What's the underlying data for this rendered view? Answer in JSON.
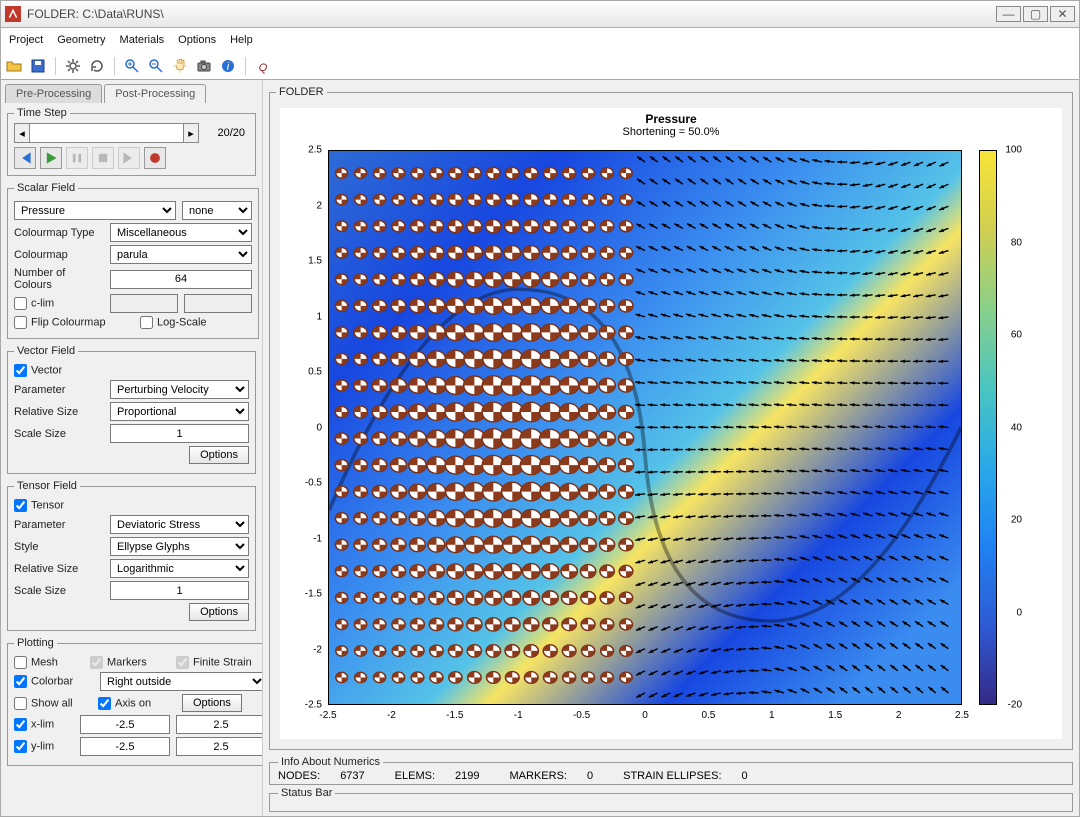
{
  "window": {
    "title": "FOLDER: C:\\Data\\RUNS\\"
  },
  "menu": [
    "Project",
    "Geometry",
    "Materials",
    "Options",
    "Help"
  ],
  "tabs": {
    "pre": "Pre-Processing",
    "post": "Post-Processing",
    "active": "post"
  },
  "timestep": {
    "legend": "Time Step",
    "label": "20/20"
  },
  "scalar": {
    "legend": "Scalar Field",
    "field": "Pressure",
    "second": "none",
    "colourmap_type_label": "Colourmap Type",
    "colourmap_type": "Miscellaneous",
    "colourmap_label": "Colourmap",
    "colourmap": "parula",
    "numcolours_label": "Number of Colours",
    "numcolours": "64",
    "clim_label": "c-lim",
    "flip_label": "Flip Colourmap",
    "log_label": "Log-Scale"
  },
  "vector": {
    "legend": "Vector Field",
    "enable_label": "Vector",
    "param_label": "Parameter",
    "param": "Perturbing Velocity",
    "relsize_label": "Relative Size",
    "relsize": "Proportional",
    "scale_label": "Scale Size",
    "scale": "1",
    "options": "Options"
  },
  "tensor": {
    "legend": "Tensor Field",
    "enable_label": "Tensor",
    "param_label": "Parameter",
    "param": "Deviatoric Stress",
    "style_label": "Style",
    "style": "Ellypse Glyphs",
    "relsize_label": "Relative Size",
    "relsize": "Logarithmic",
    "scale_label": "Scale Size",
    "scale": "1",
    "options": "Options"
  },
  "plotting": {
    "legend": "Plotting",
    "mesh": "Mesh",
    "markers": "Markers",
    "finite_strain": "Finite Strain",
    "colorbar": "Colorbar",
    "colorbar_pos": "Right outside",
    "showall": "Show all",
    "axis_on": "Axis on",
    "options": "Options",
    "xlim": "x-lim",
    "ylim": "y-lim",
    "xmin": "-2.5",
    "xmax": "2.5",
    "ymin": "-2.5",
    "ymax": "2.5"
  },
  "plot_frame_legend": "FOLDER",
  "info": {
    "legend": "Info About Numerics",
    "nodes_l": "NODES:",
    "nodes": "6737",
    "elems_l": "ELEMS:",
    "elems": "2199",
    "markers_l": "MARKERS:",
    "markers": "0",
    "strain_l": "STRAIN ELLIPSES:",
    "strain": "0"
  },
  "statusbar_legend": "Status Bar",
  "chart_data": {
    "type": "heatmap",
    "title": "Pressure",
    "subtitle": "Shortening = 50.0%",
    "xlabel": "",
    "ylabel": "",
    "xlim": [
      -2.5,
      2.5
    ],
    "ylim": [
      -2.5,
      2.5
    ],
    "xticks": [
      -2.5,
      -2,
      -1.5,
      -1,
      -0.5,
      0,
      0.5,
      1,
      1.5,
      2,
      2.5
    ],
    "yticks": [
      -2.5,
      -2,
      -1.5,
      -1,
      -0.5,
      0,
      0.5,
      1,
      1.5,
      2,
      2.5
    ],
    "colorbar_ticks": [
      -20,
      0,
      20,
      40,
      60,
      80,
      100
    ],
    "scalar_range": [
      -30,
      110
    ],
    "overlays": {
      "vector_field": "Perturbing Velocity (arrows, proportional scaling)",
      "tensor_field": "Deviatoric Stress (ellipse glyphs, logarithmic scaling)"
    },
    "description": "2D pressure scalar field with fold-like interface; tensor ellipse glyphs dominate left half, velocity vectors form two counter-rotating vortices on right half."
  }
}
